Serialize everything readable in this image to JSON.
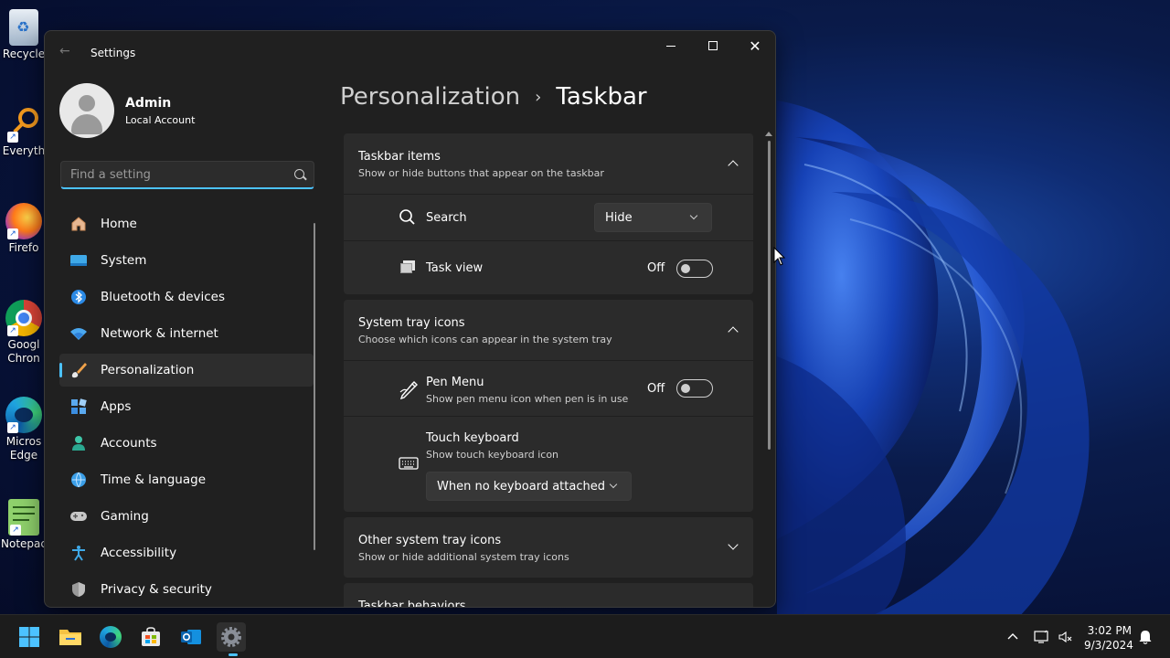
{
  "desktop": {
    "icons": [
      {
        "label": "Recycle",
        "icon": "recycle-bin-icon"
      },
      {
        "label": "Everyth",
        "icon": "everything-search-icon"
      },
      {
        "label": "Firefo",
        "icon": "firefox-icon"
      },
      {
        "label": "Googl\nChron",
        "label_line1": "Googl",
        "label_line2": "Chron",
        "icon": "chrome-icon"
      },
      {
        "label_line1": "Micros",
        "label_line2": "Edge",
        "icon": "edge-icon"
      },
      {
        "label": "Notepac",
        "icon": "notepad-icon"
      }
    ]
  },
  "window": {
    "title": "Settings",
    "back_icon": "back-arrow-icon",
    "controls": {
      "minimize": "minimize-icon",
      "maximize": "maximize-icon",
      "close": "close-icon"
    }
  },
  "user": {
    "name": "Admin",
    "account_type": "Local Account"
  },
  "search": {
    "placeholder": "Find a setting",
    "value": ""
  },
  "sidebar": {
    "items": [
      {
        "label": "Home",
        "icon": "home-icon",
        "active": false
      },
      {
        "label": "System",
        "icon": "system-icon",
        "active": false
      },
      {
        "label": "Bluetooth & devices",
        "icon": "bluetooth-icon",
        "active": false
      },
      {
        "label": "Network & internet",
        "icon": "network-icon",
        "active": false
      },
      {
        "label": "Personalization",
        "icon": "brush-icon",
        "active": true
      },
      {
        "label": "Apps",
        "icon": "apps-icon",
        "active": false
      },
      {
        "label": "Accounts",
        "icon": "accounts-icon",
        "active": false
      },
      {
        "label": "Time & language",
        "icon": "globe-clock-icon",
        "active": false
      },
      {
        "label": "Gaming",
        "icon": "gamepad-icon",
        "active": false
      },
      {
        "label": "Accessibility",
        "icon": "accessibility-icon",
        "active": false
      },
      {
        "label": "Privacy & security",
        "icon": "shield-icon",
        "active": false
      }
    ]
  },
  "breadcrumb": {
    "parent": "Personalization",
    "separator": "›",
    "current": "Taskbar"
  },
  "sections": {
    "taskbar_items": {
      "title": "Taskbar items",
      "subtitle": "Show or hide buttons that appear on the taskbar",
      "expanded": true,
      "rows": {
        "search": {
          "label": "Search",
          "icon": "search-icon",
          "value": "Hide"
        },
        "task_view": {
          "label": "Task view",
          "icon": "task-view-icon",
          "state_label": "Off",
          "on": false
        }
      }
    },
    "system_tray_icons": {
      "title": "System tray icons",
      "subtitle": "Choose which icons can appear in the system tray",
      "expanded": true,
      "rows": {
        "pen_menu": {
          "label": "Pen Menu",
          "sub": "Show pen menu icon when pen is in use",
          "icon": "pen-icon",
          "state_label": "Off",
          "on": false
        },
        "touch_keyboard": {
          "label": "Touch keyboard",
          "sub": "Show touch keyboard icon",
          "icon": "keyboard-icon",
          "value": "When no keyboard attached"
        }
      }
    },
    "other_system_tray_icons": {
      "title": "Other system tray icons",
      "subtitle": "Show or hide additional system tray icons",
      "expanded": false
    },
    "taskbar_behaviors": {
      "title": "Taskbar behaviors"
    }
  },
  "taskbar": {
    "pinned": [
      {
        "name": "start-button",
        "icon": "windows-logo-icon"
      },
      {
        "name": "file-explorer",
        "icon": "folder-icon"
      },
      {
        "name": "edge",
        "icon": "edge-icon"
      },
      {
        "name": "store",
        "icon": "store-icon"
      },
      {
        "name": "outlook",
        "icon": "outlook-icon"
      },
      {
        "name": "settings",
        "icon": "gear-icon",
        "active": true
      }
    ],
    "tray": {
      "time": "3:02 PM",
      "date": "9/3/2024",
      "icons": [
        "chevron-up-icon",
        "network-icon",
        "speaker-muted-icon",
        "notification-bell-icon"
      ]
    }
  },
  "colors": {
    "accent": "#4cc2ff",
    "window_bg": "#202020",
    "card_bg": "#2b2b2b",
    "taskbar_bg": "#1c1c1c"
  }
}
